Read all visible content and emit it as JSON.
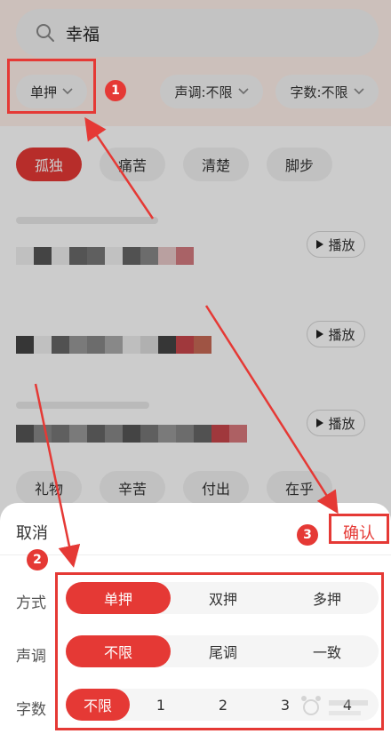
{
  "search": {
    "query": "幸福"
  },
  "filters": {
    "rhyme": "单押",
    "tone": "声调:不限",
    "count": "字数:不限"
  },
  "tags_top": [
    {
      "label": "孤独",
      "active": true
    },
    {
      "label": "痛苦",
      "active": false
    },
    {
      "label": "清楚",
      "active": false
    },
    {
      "label": "脚步",
      "active": false
    }
  ],
  "results": [
    {
      "play_label": "播放"
    },
    {
      "play_label": "播放"
    },
    {
      "play_label": "播放"
    }
  ],
  "tags_bottom": [
    {
      "label": "礼物"
    },
    {
      "label": "辛苦"
    },
    {
      "label": "付出"
    },
    {
      "label": "在乎"
    }
  ],
  "sheet": {
    "cancel": "取消",
    "confirm": "确认",
    "rows": [
      {
        "label": "方式",
        "options": [
          "单押",
          "双押",
          "多押"
        ],
        "selected": 0
      },
      {
        "label": "声调",
        "options": [
          "不限",
          "尾调",
          "一致"
        ],
        "selected": 0
      },
      {
        "label": "字数",
        "options": [
          "不限",
          "1",
          "2",
          "3",
          "4"
        ],
        "selected": 0
      }
    ]
  },
  "annotations": {
    "step1": "1",
    "step2": "2",
    "step3": "3"
  },
  "colors": {
    "accent": "#e53935",
    "dim_overlay": "rgba(0,0,0,0.2)"
  }
}
